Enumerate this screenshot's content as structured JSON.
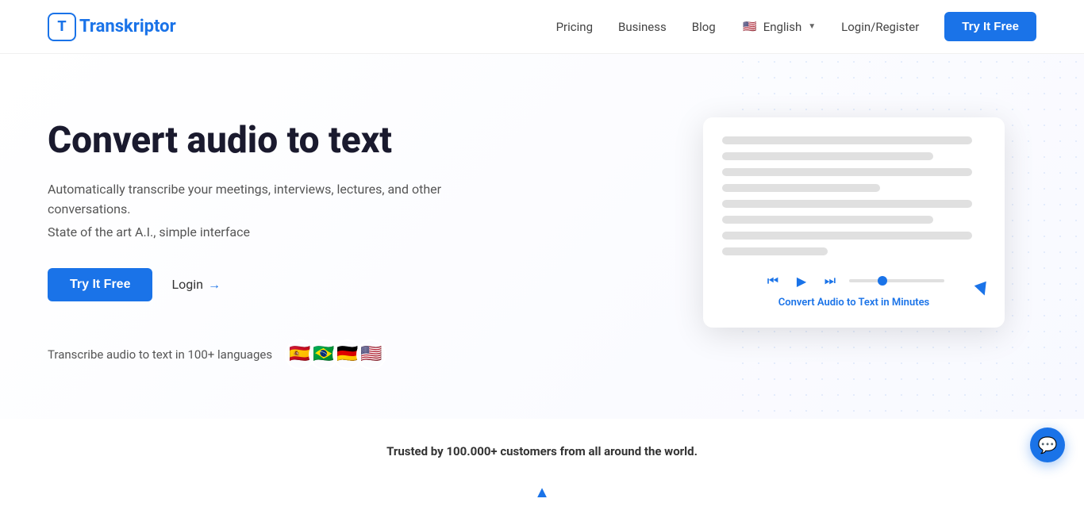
{
  "header": {
    "logo_text": "ranskriptor",
    "logo_letter": "T",
    "nav": {
      "pricing": "Pricing",
      "business": "Business",
      "blog": "Blog",
      "language": "English",
      "login_register": "Login/Register",
      "try_free": "Try It Free"
    }
  },
  "hero": {
    "title": "Convert audio to text",
    "subtitle": "Automatically transcribe your meetings, interviews, lectures, and other conversations.",
    "tagline": "State of the art A.I., simple interface",
    "cta_primary": "Try It Free",
    "cta_login": "Login",
    "languages_label": "Transcribe audio to text in 100+ languages",
    "flags": [
      "🇪🇸",
      "🇧🇷",
      "🇩🇪",
      "🇺🇸"
    ]
  },
  "demo": {
    "caption": "Convert Audio to Text in Minutes"
  },
  "trust": {
    "text": "Trusted by 100.000+ customers from all around the world."
  },
  "chat": {
    "aria_label": "Chat support"
  }
}
